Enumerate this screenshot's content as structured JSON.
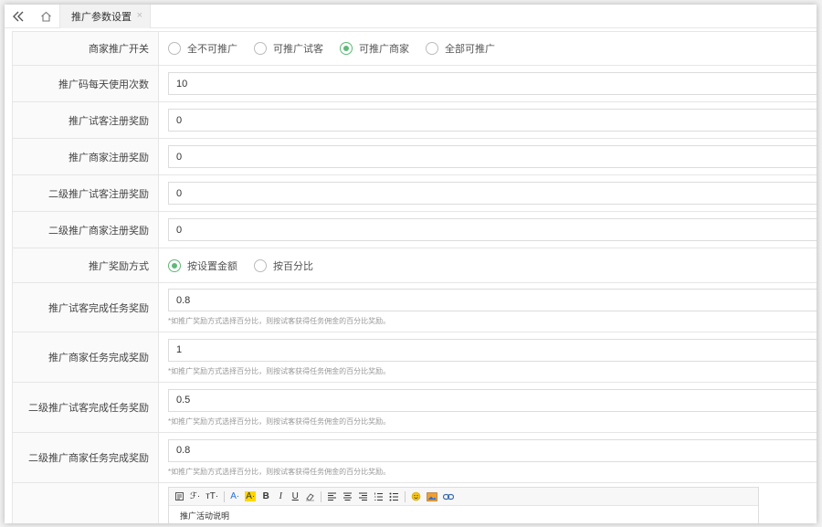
{
  "tabbar": {
    "back_icon": "double-chevron-left-icon",
    "home_icon": "home-icon",
    "active_tab": "推广参数设置",
    "close_glyph": "×"
  },
  "form": {
    "merchant_switch": {
      "label": "商家推广开关",
      "options": [
        "全不可推广",
        "可推广试客",
        "可推广商家",
        "全部可推广"
      ],
      "selected": "可推广商家"
    },
    "daily_code_uses": {
      "label": "推广码每天使用次数",
      "value": "10"
    },
    "tester_register_reward": {
      "label": "推广试客注册奖励",
      "value": "0"
    },
    "merchant_register_reward": {
      "label": "推广商家注册奖励",
      "value": "0"
    },
    "l2_tester_register_reward": {
      "label": "二级推广试客注册奖励",
      "value": "0"
    },
    "l2_merchant_register_reward": {
      "label": "二级推广商家注册奖励",
      "value": "0"
    },
    "reward_mode": {
      "label": "推广奖励方式",
      "options": [
        "按设置金额",
        "按百分比"
      ],
      "selected": "按设置金额"
    },
    "tester_task_reward": {
      "label": "推广试客完成任务奖励",
      "value": "0.8",
      "hint": "*如推广奖励方式选择百分比，则按试客获得任务佣金的百分比奖励。"
    },
    "merchant_task_reward": {
      "label": "推广商家任务完成奖励",
      "value": "1",
      "hint": "*如推广奖励方式选择百分比，则按试客获得任务佣金的百分比奖励。"
    },
    "l2_tester_task_reward": {
      "label": "二级推广试客完成任务奖励",
      "value": "0.5",
      "hint": "*如推广奖励方式选择百分比，则按试客获得任务佣金的百分比奖励。"
    },
    "l2_merchant_task_reward": {
      "label": "二级推广商家任务完成奖励",
      "value": "0.8",
      "hint": "*如推广奖励方式选择百分比，则按试客获得任务佣金的百分比奖励。"
    }
  },
  "editor": {
    "toolbar": {
      "source_icon": "source-code-icon",
      "font_family": "ℱ·",
      "font_size": "ᴛT·",
      "font_color": "A·",
      "bg_color": "A·",
      "bold": "B",
      "italic": "I",
      "underline": "U",
      "eraser_icon": "eraser-icon",
      "align_left_icon": "align-left-icon",
      "align_center_icon": "align-center-icon",
      "align_right_icon": "align-right-icon",
      "ordered_list_icon": "ordered-list-icon",
      "unordered_list_icon": "unordered-list-icon",
      "emoji_icon": "emoji-icon",
      "image_icon": "image-icon",
      "link_icon": "link-icon"
    },
    "content": "推广活动说明"
  },
  "colors": {
    "accent": "#5fb878",
    "border": "#e6e6e6",
    "label_bg": "#fafafa"
  }
}
